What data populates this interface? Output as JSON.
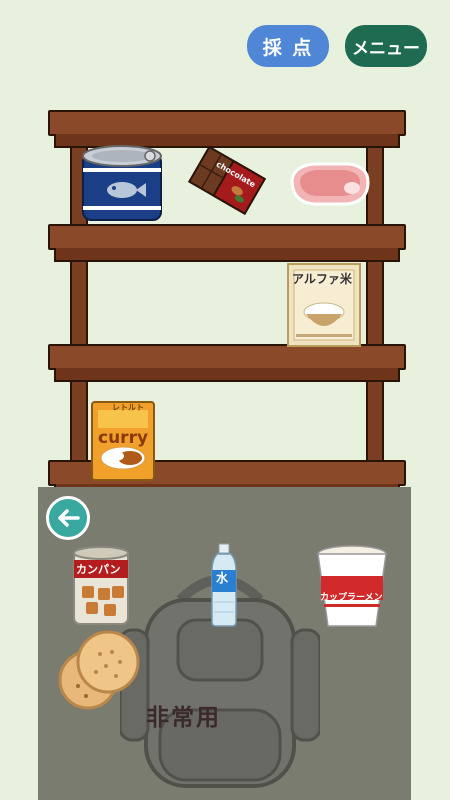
{
  "header": {
    "score_label": "採 点",
    "menu_label": "メニュー"
  },
  "shelf": {
    "items": [
      {
        "name": "canned-fish",
        "label": ""
      },
      {
        "name": "chocolate",
        "label": "chocolate"
      },
      {
        "name": "meat",
        "label": ""
      },
      {
        "name": "alpha-rice",
        "label": "アルファ米"
      },
      {
        "name": "retort-curry",
        "label_top": "レトルト",
        "label_main": "curry"
      }
    ]
  },
  "bag": {
    "label": "非常用",
    "items": [
      {
        "name": "kanpan-can",
        "label": "カンパン"
      },
      {
        "name": "water-bottle",
        "label": "水"
      },
      {
        "name": "cup-noodle",
        "label": "カップラーメン"
      },
      {
        "name": "crackers",
        "label": ""
      }
    ]
  },
  "colors": {
    "background": "#e8f1de",
    "score_button": "#4f86d6",
    "menu_button": "#1f6b52",
    "back_button": "#39a9a0",
    "bag_area": "#7a7c70"
  }
}
